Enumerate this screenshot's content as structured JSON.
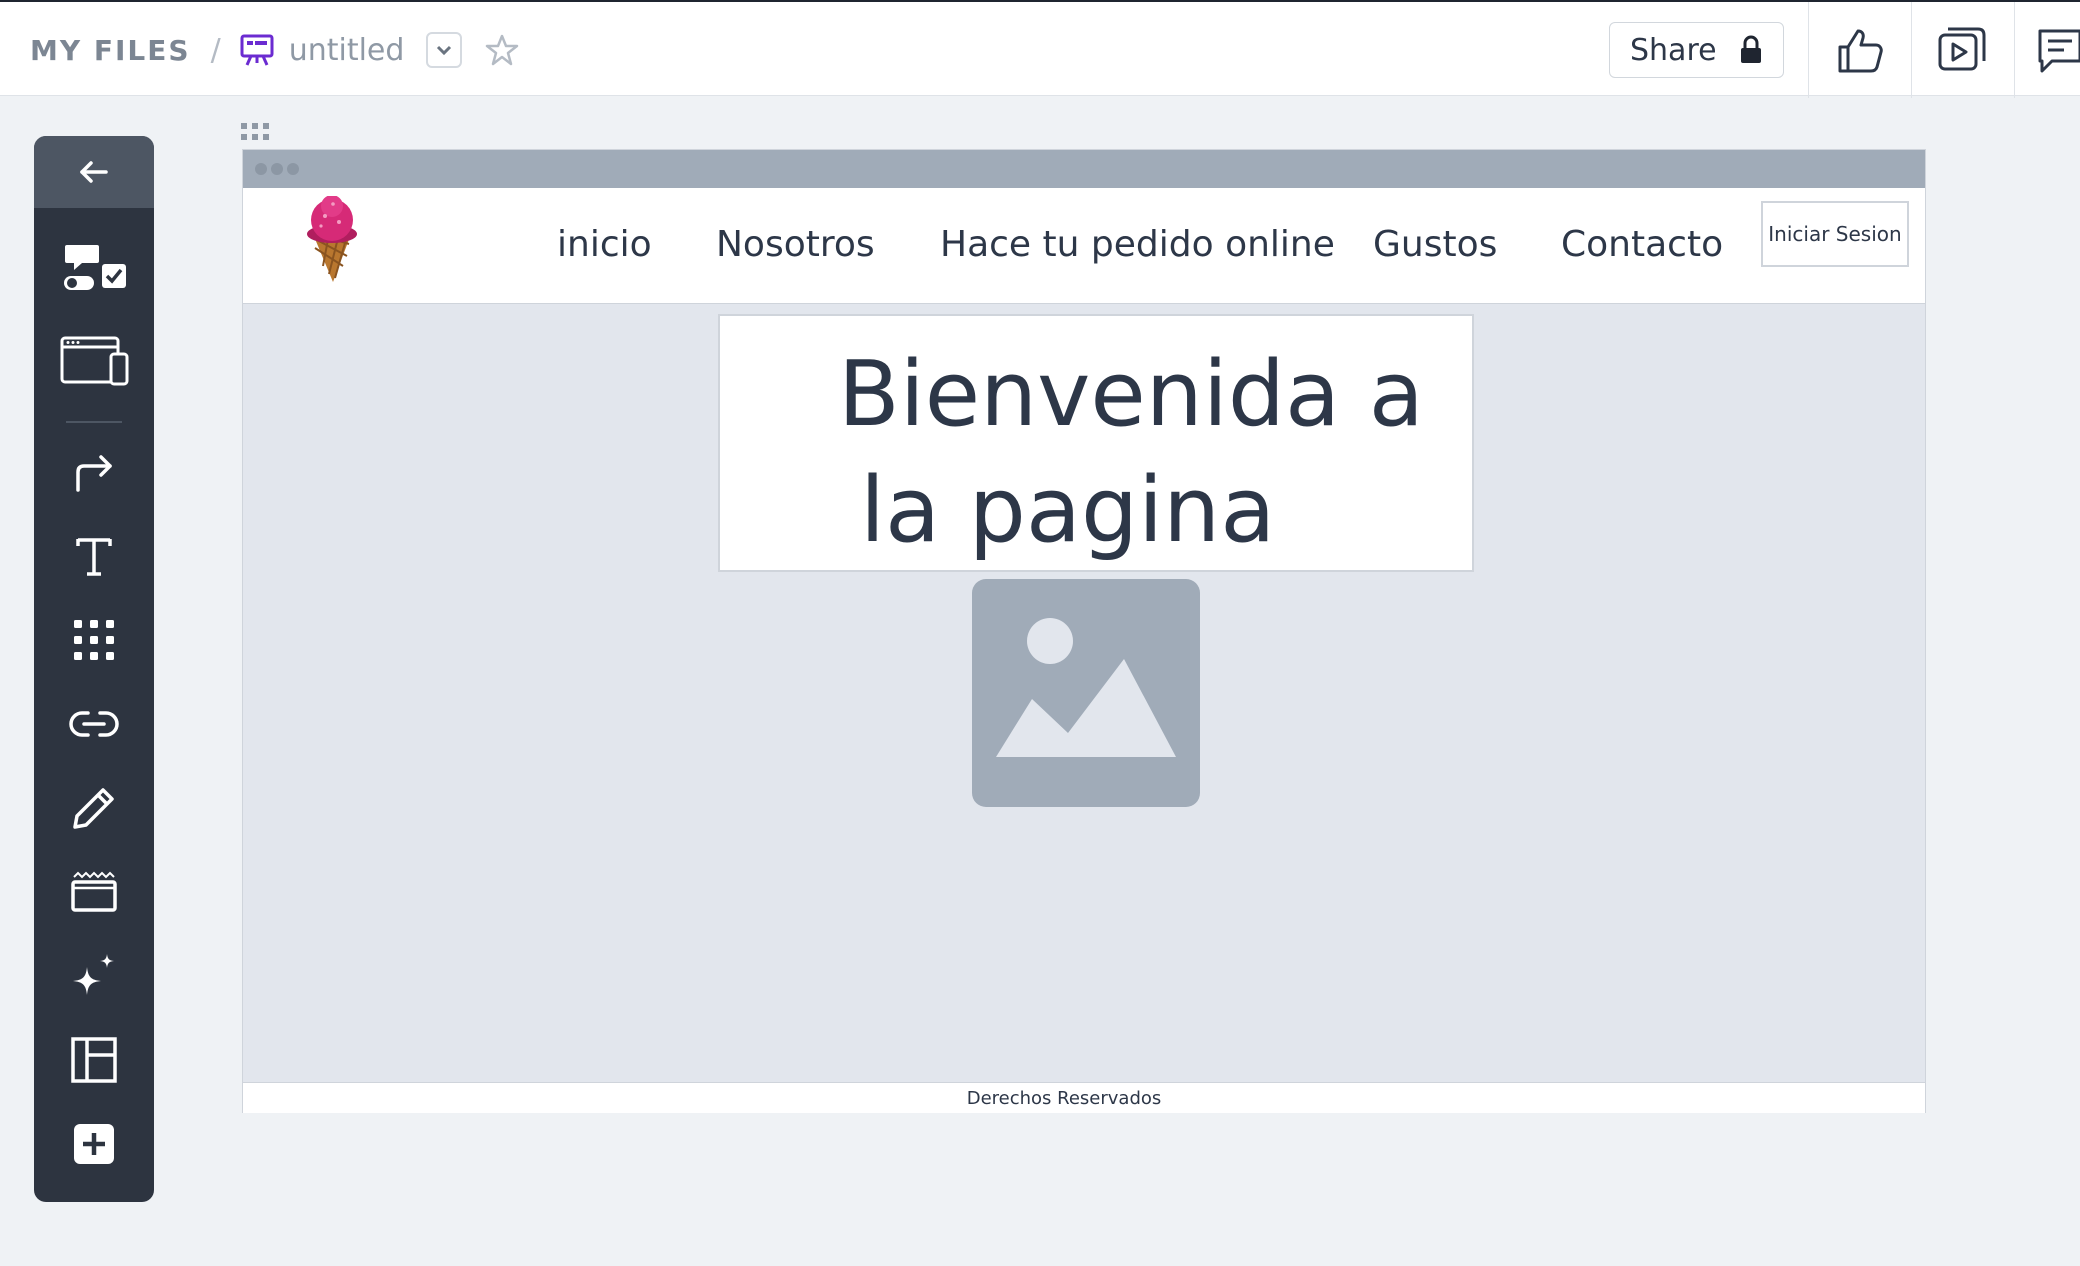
{
  "header": {
    "breadcrumb_root": "MY FILES",
    "separator": "/",
    "doc_title": "untitled",
    "share_label": "Share",
    "icons": [
      "prototype-icon",
      "chevron-down-icon",
      "star-icon",
      "lock-icon",
      "thumbs-up-icon",
      "play-presentation-icon",
      "comment-icon"
    ]
  },
  "toolbar": {
    "items": [
      "back-arrow-icon",
      "components-icon",
      "device-frames-icon",
      "connector-arrow-icon",
      "text-icon",
      "grid-apps-icon",
      "link-icon",
      "pencil-icon",
      "container-icon",
      "ai-sparkle-icon",
      "layout-icon",
      "add-icon"
    ]
  },
  "site": {
    "nav": [
      "inicio",
      "Nosotros",
      "Hace tu pedido online",
      "Gustos",
      "Contacto"
    ],
    "login_label": "Iniciar Sesion",
    "hero_line1": "Bienvenida a",
    "hero_line2": "la pagina",
    "footer_text": "Derechos Reservados",
    "logo": "ice-cream-icon",
    "image_placeholder": "image-placeholder-icon"
  },
  "colors": {
    "toolbar_bg": "#2d3440",
    "frame_bar": "#a0abb8",
    "canvas_bg": "#e2e6ed",
    "accent_purple": "#6b2bd1",
    "text_dark": "#2d3748"
  }
}
